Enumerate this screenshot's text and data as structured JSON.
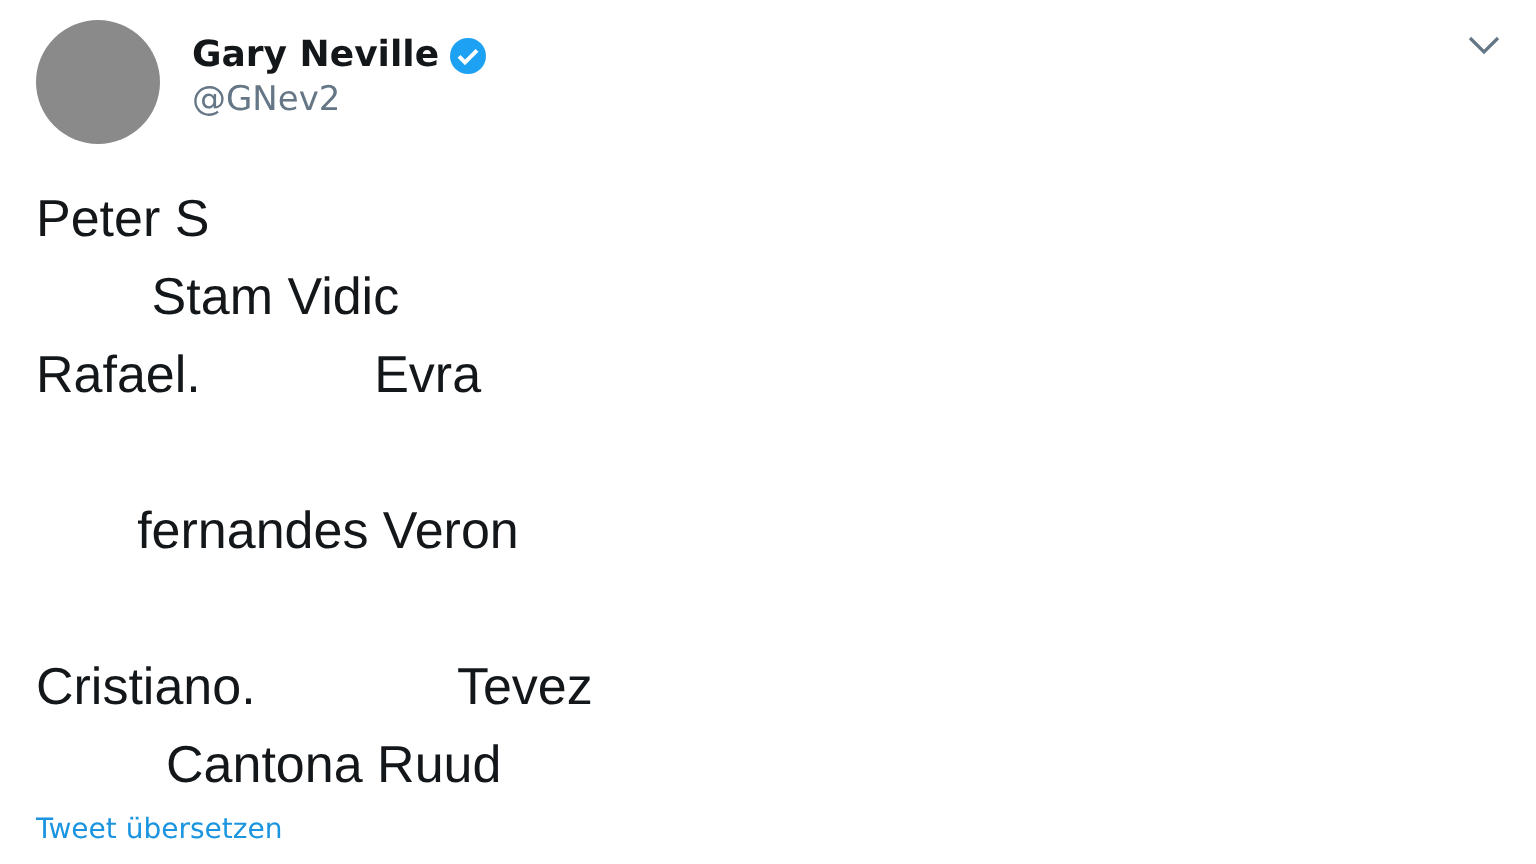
{
  "author": {
    "name": "Gary Neville",
    "verified": true,
    "handle": "@GNev2"
  },
  "tweet": {
    "text": "Peter S\n        Stam Vidic\nRafael.            Evra\n\n       fernandes Veron\n\nCristiano.              Tevez\n         Cantona Ruud"
  },
  "translate_link": "Tweet übersetzen"
}
